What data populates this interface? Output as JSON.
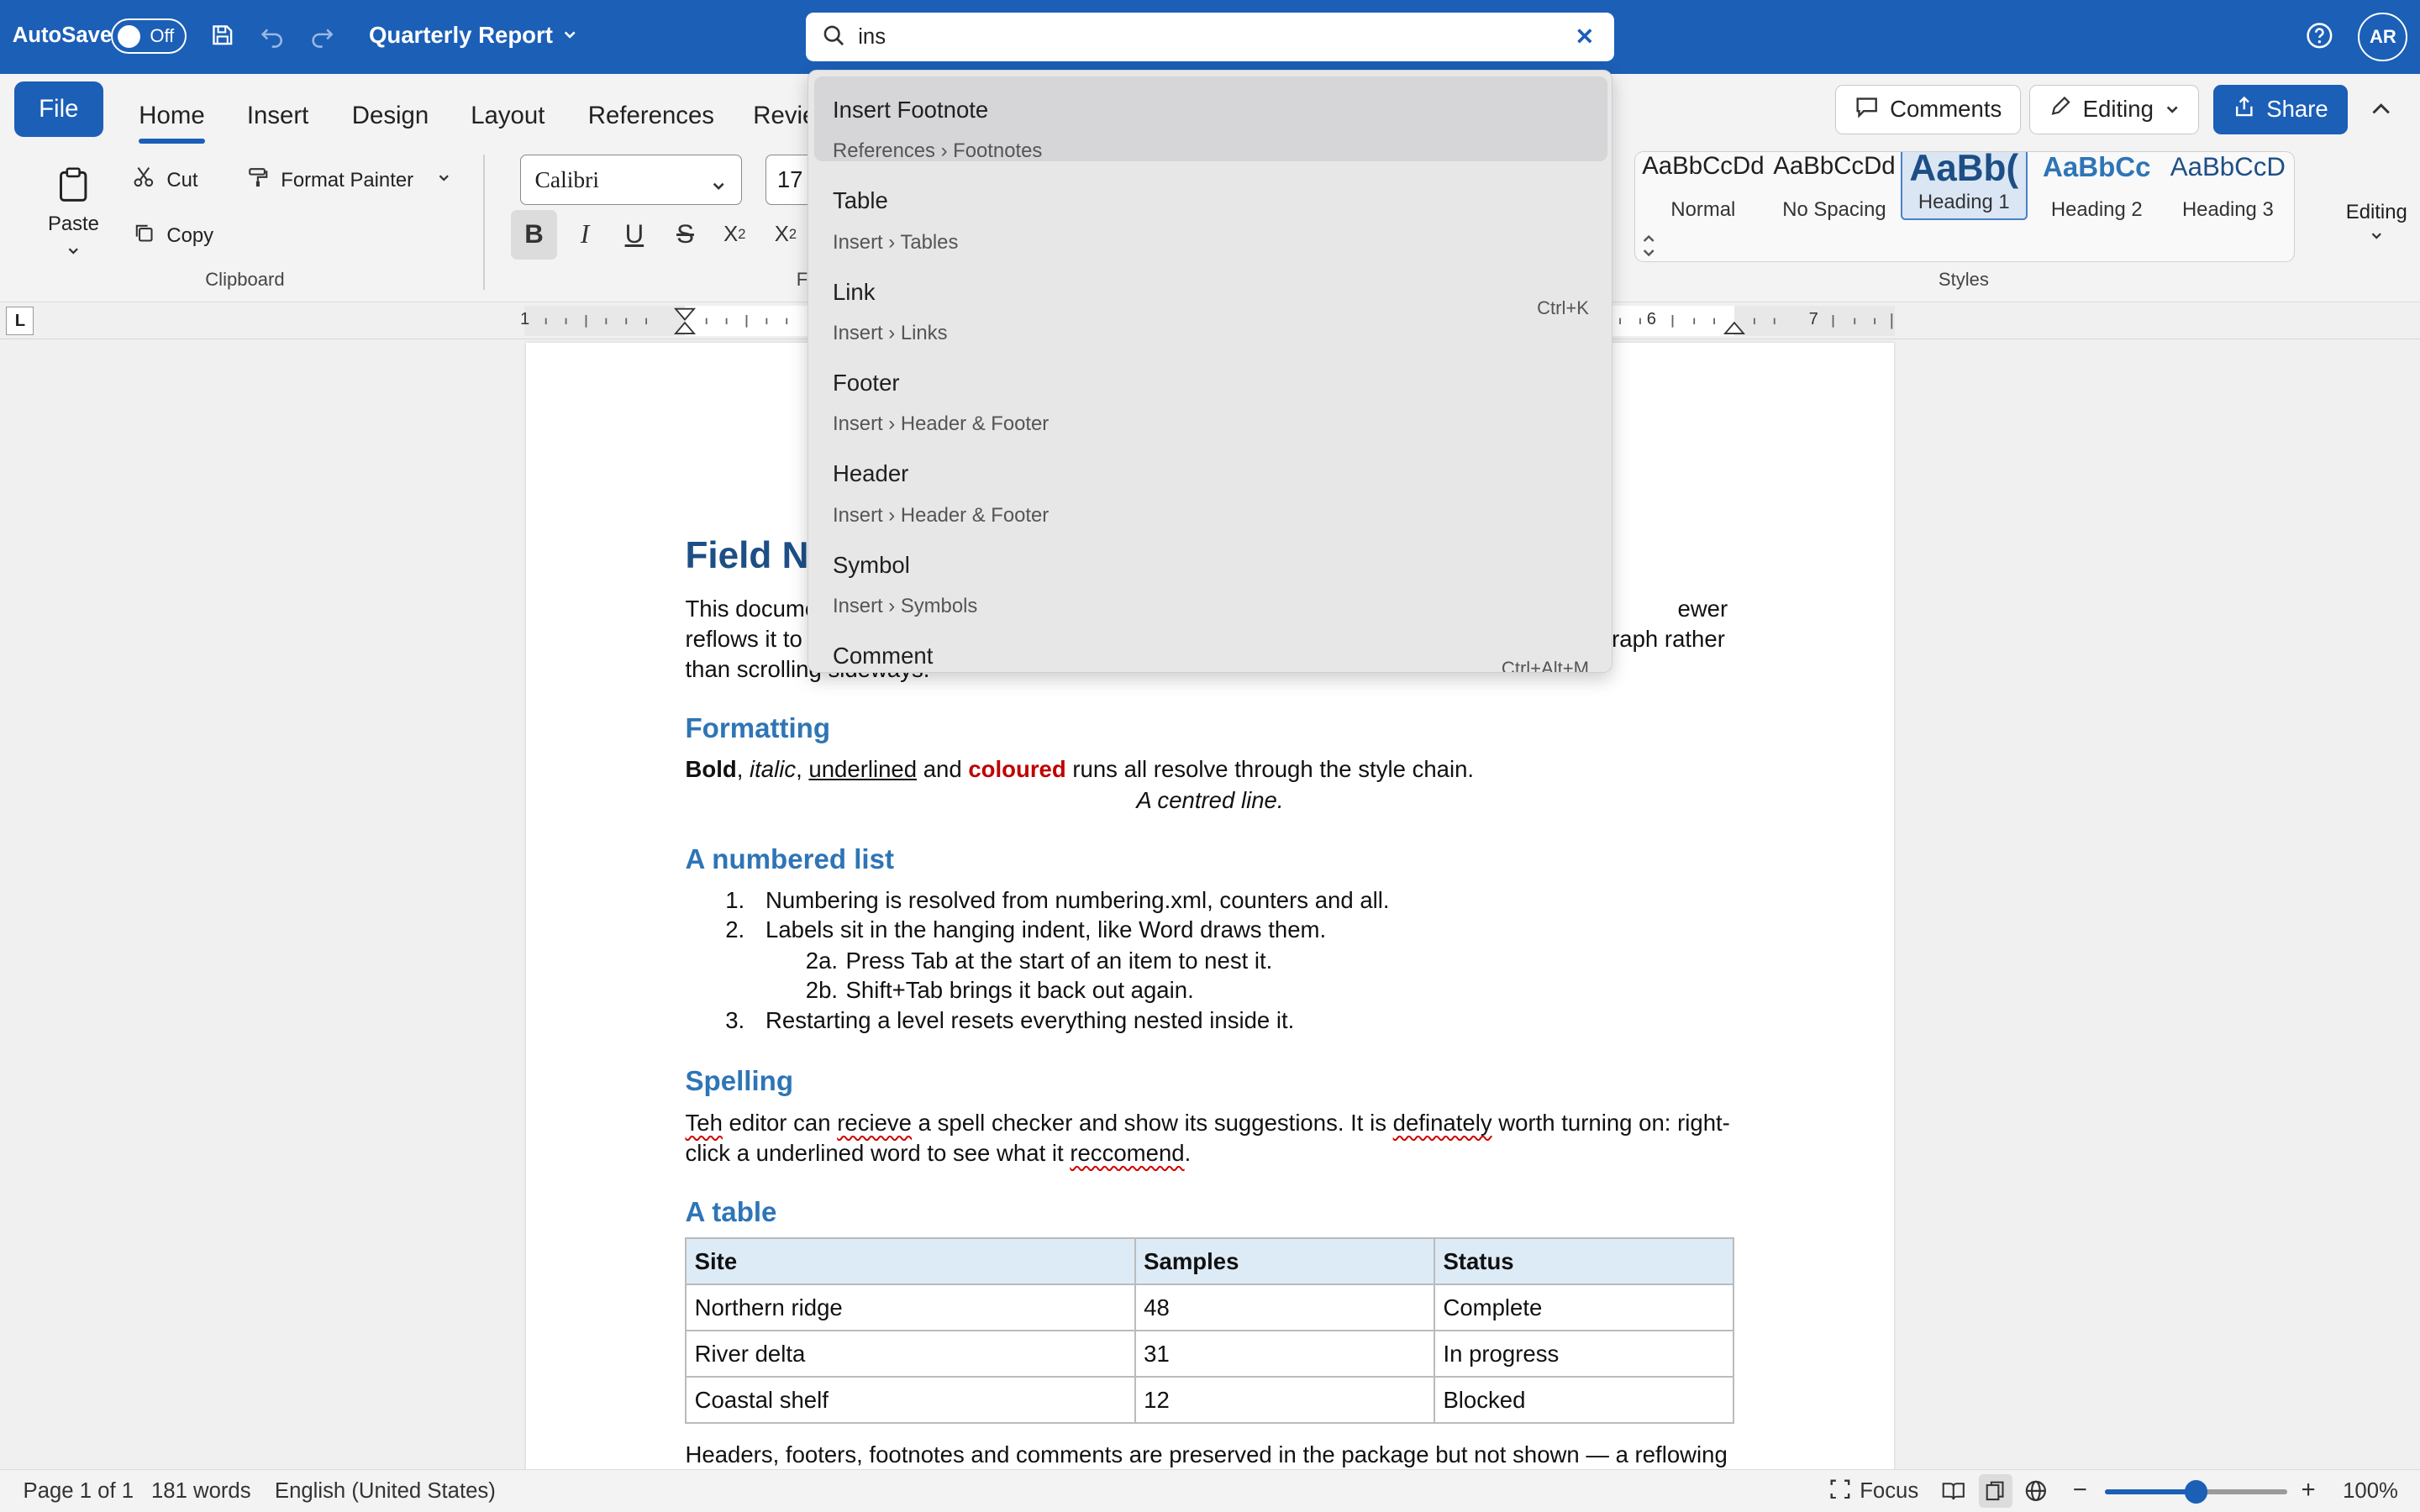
{
  "titlebar": {
    "autosave_label": "AutoSave",
    "autosave_state": "Off",
    "document_title": "Quarterly Report",
    "search_value": "ins",
    "avatar_initials": "AR"
  },
  "ribbon_tabs": {
    "file": "File",
    "tabs": [
      "Home",
      "Insert",
      "Design",
      "Layout",
      "References",
      "Revie"
    ],
    "active_tab": "Home",
    "comments": "Comments",
    "editing": "Editing",
    "share": "Share"
  },
  "ribbon": {
    "paste": "Paste",
    "cut": "Cut",
    "copy": "Copy",
    "format_painter": "Format Painter",
    "clipboard_group": "Clipboard",
    "font_group_partial": "F",
    "font_name": "Calibri",
    "font_size": "17",
    "styles": [
      {
        "preview": "AaBbCcDd",
        "name": "Normal"
      },
      {
        "preview": "AaBbCcDd",
        "name": "No Spacing"
      },
      {
        "preview": "AaBb(",
        "name": "Heading 1"
      },
      {
        "preview": "AaBbCc",
        "name": "Heading 2"
      },
      {
        "preview": "AaBbCcD",
        "name": "Heading 3"
      }
    ],
    "styles_group": "Styles",
    "editing_label": "Editing"
  },
  "ruler": {
    "numbers": [
      "1",
      "6",
      "7"
    ]
  },
  "search_results": [
    {
      "title": "Insert Footnote",
      "path": "References › Footnotes",
      "shortcut": ""
    },
    {
      "title": "Table",
      "path": "Insert › Tables",
      "shortcut": ""
    },
    {
      "title": "Link",
      "path": "Insert › Links",
      "shortcut": "Ctrl+K"
    },
    {
      "title": "Footer",
      "path": "Insert › Header & Footer",
      "shortcut": ""
    },
    {
      "title": "Header",
      "path": "Insert › Header & Footer",
      "shortcut": ""
    },
    {
      "title": "Symbol",
      "path": "Insert › Symbols",
      "shortcut": ""
    },
    {
      "title": "Comment",
      "path": "",
      "shortcut": "Ctrl+Alt+M"
    }
  ],
  "document": {
    "title_partial": "Field No",
    "intro_l1a": "This docume",
    "intro_l1b": "ewer",
    "intro_l2a": "reflows it to",
    "intro_l2b": "graph rather",
    "intro_l3": "than scrolling sideways.",
    "h_formatting": "Formatting",
    "fmt_bold": "Bold",
    "fmt_italic": "italic",
    "fmt_underlined": "underlined",
    "fmt_and": " and ",
    "fmt_coloured": "coloured",
    "fmt_rest": " runs all resolve through the style chain.",
    "centred_line": "A centred line.",
    "h_list": "A numbered list",
    "list": [
      {
        "num": "1.",
        "text": "Numbering is resolved from numbering.xml, counters and all."
      },
      {
        "num": "2.",
        "text": "Labels sit in the hanging indent, like Word draws them."
      },
      {
        "num": "2a.",
        "text": "Press Tab at the start of an item to nest it."
      },
      {
        "num": "2b.",
        "text": "Shift+Tab brings it back out again."
      },
      {
        "num": "3.",
        "text": "Restarting a level resets everything nested inside it."
      }
    ],
    "h_spelling": "Spelling",
    "sp_w1": "Teh",
    "sp_t1": " editor can ",
    "sp_w2": "recieve",
    "sp_t2": " a spell checker and show its suggestions. It is ",
    "sp_w3": "definately",
    "sp_t3": " worth turning on: right-",
    "sp_t4": "click a underlined word to see what it ",
    "sp_w4": "reccomend",
    "sp_t5": ".",
    "h_table": "A table",
    "table_headers": [
      "Site",
      "Samples",
      "Status"
    ],
    "table_rows": [
      [
        "Northern ridge",
        "48",
        "Complete"
      ],
      [
        "River delta",
        "31",
        "In progress"
      ],
      [
        "Coastal shelf",
        "12",
        "Blocked"
      ]
    ],
    "footer_para": "Headers, footers, footnotes and comments are preserved in the package but not shown — a reflowing"
  },
  "statusbar": {
    "page": "Page 1 of 1",
    "words": "181 words",
    "language": "English (United States)",
    "focus": "Focus",
    "zoom": "100%",
    "zoom_fraction": 0.5
  },
  "colors": {
    "brand": "#1b5fb7",
    "heading": "#2e75b6",
    "title": "#1d4f86",
    "accent_red": "#c00000"
  }
}
